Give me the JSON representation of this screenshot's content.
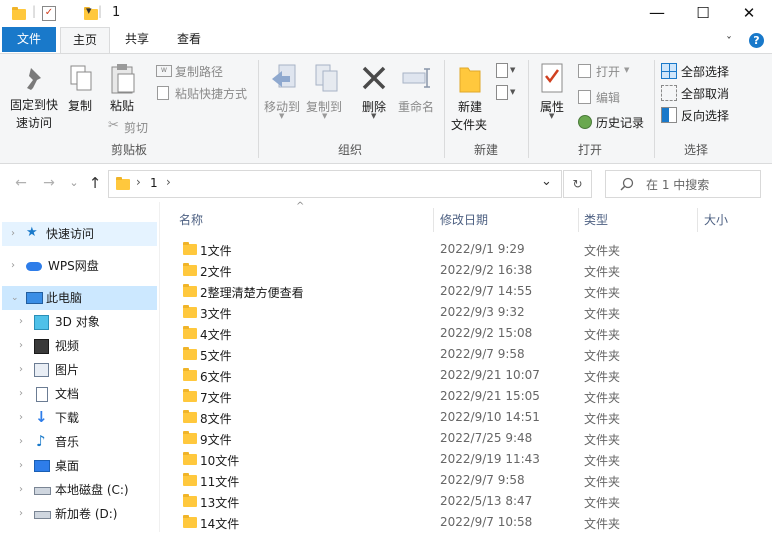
{
  "window": {
    "title": "1",
    "qa_pin_sep": "|",
    "qa_dropdown": "▾",
    "minimize": "—",
    "maximize": "☐",
    "close": "✕"
  },
  "ribbon_tabs": [
    "文件",
    "主页",
    "共享",
    "查看"
  ],
  "help": "?",
  "collapse_chevron": "ˇ",
  "ribbon": {
    "pin": "固定到快\n速访问",
    "pin_l1": "固定到快",
    "pin_l2": "速访问",
    "copy": "复制",
    "paste": "粘贴",
    "copy_path": "复制路径",
    "paste_shortcut": "粘贴快捷方式",
    "cut": "剪切",
    "move_to": "移动到",
    "copy_to": "复制到",
    "delete": "删除",
    "rename": "重命名",
    "new_folder_l1": "新建",
    "new_folder_l2": "文件夹",
    "properties": "属性",
    "open": "打开",
    "edit": "编辑",
    "history": "历史记录",
    "select_all": "全部选择",
    "select_none": "全部取消",
    "invert": "反向选择",
    "groups": [
      "剪贴板",
      "组织",
      "新建",
      "打开",
      "选择"
    ]
  },
  "address": {
    "sep": "›",
    "path": "1",
    "dropdown": "⌄",
    "refresh": "↻",
    "search_placeholder": "在 1 中搜索"
  },
  "nav_arrows": {
    "back": "←",
    "forward": "→",
    "recent": "⌄",
    "up": "↑"
  },
  "nav_pane": [
    {
      "label": "快速访问",
      "icon": "star-icon"
    },
    {
      "label": "WPS网盘",
      "icon": "cloud-icon"
    },
    {
      "label": "此电脑",
      "icon": "computer-icon"
    },
    {
      "label": "3D 对象",
      "icon": "cube-icon"
    },
    {
      "label": "视频",
      "icon": "film-icon"
    },
    {
      "label": "图片",
      "icon": "picture-icon"
    },
    {
      "label": "文档",
      "icon": "document-icon"
    },
    {
      "label": "下载",
      "icon": "download-icon"
    },
    {
      "label": "音乐",
      "icon": "music-icon"
    },
    {
      "label": "桌面",
      "icon": "desktop-icon"
    },
    {
      "label": "本地磁盘 (C:)",
      "icon": "drive-icon"
    },
    {
      "label": "新加卷 (D:)",
      "icon": "drive-icon"
    }
  ],
  "columns": {
    "name": "名称",
    "modified": "修改日期",
    "type": "类型",
    "size": "大小",
    "sort": "^"
  },
  "files": [
    {
      "name": "1文件",
      "date": "2022/9/1 9:29",
      "type": "文件夹"
    },
    {
      "name": "2文件",
      "date": "2022/9/2 16:38",
      "type": "文件夹"
    },
    {
      "name": "2整理清楚方便查看",
      "date": "2022/9/7 14:55",
      "type": "文件夹"
    },
    {
      "name": "3文件",
      "date": "2022/9/3 9:32",
      "type": "文件夹"
    },
    {
      "name": "4文件",
      "date": "2022/9/2 15:08",
      "type": "文件夹"
    },
    {
      "name": "5文件",
      "date": "2022/9/7 9:58",
      "type": "文件夹"
    },
    {
      "name": "6文件",
      "date": "2022/9/21 10:07",
      "type": "文件夹"
    },
    {
      "name": "7文件",
      "date": "2022/9/21 15:05",
      "type": "文件夹"
    },
    {
      "name": "8文件",
      "date": "2022/9/10 14:51",
      "type": "文件夹"
    },
    {
      "name": "9文件",
      "date": "2022/7/25 9:48",
      "type": "文件夹"
    },
    {
      "name": "10文件",
      "date": "2022/9/19 11:43",
      "type": "文件夹"
    },
    {
      "name": "11文件",
      "date": "2022/9/7 9:58",
      "type": "文件夹"
    },
    {
      "name": "13文件",
      "date": "2022/5/13 8:47",
      "type": "文件夹"
    },
    {
      "name": "14文件",
      "date": "2022/9/7 10:58",
      "type": "文件夹"
    }
  ],
  "colors": {
    "accent": "#1979ca",
    "folder": "#ffc83d",
    "selected": "#cce8ff"
  }
}
